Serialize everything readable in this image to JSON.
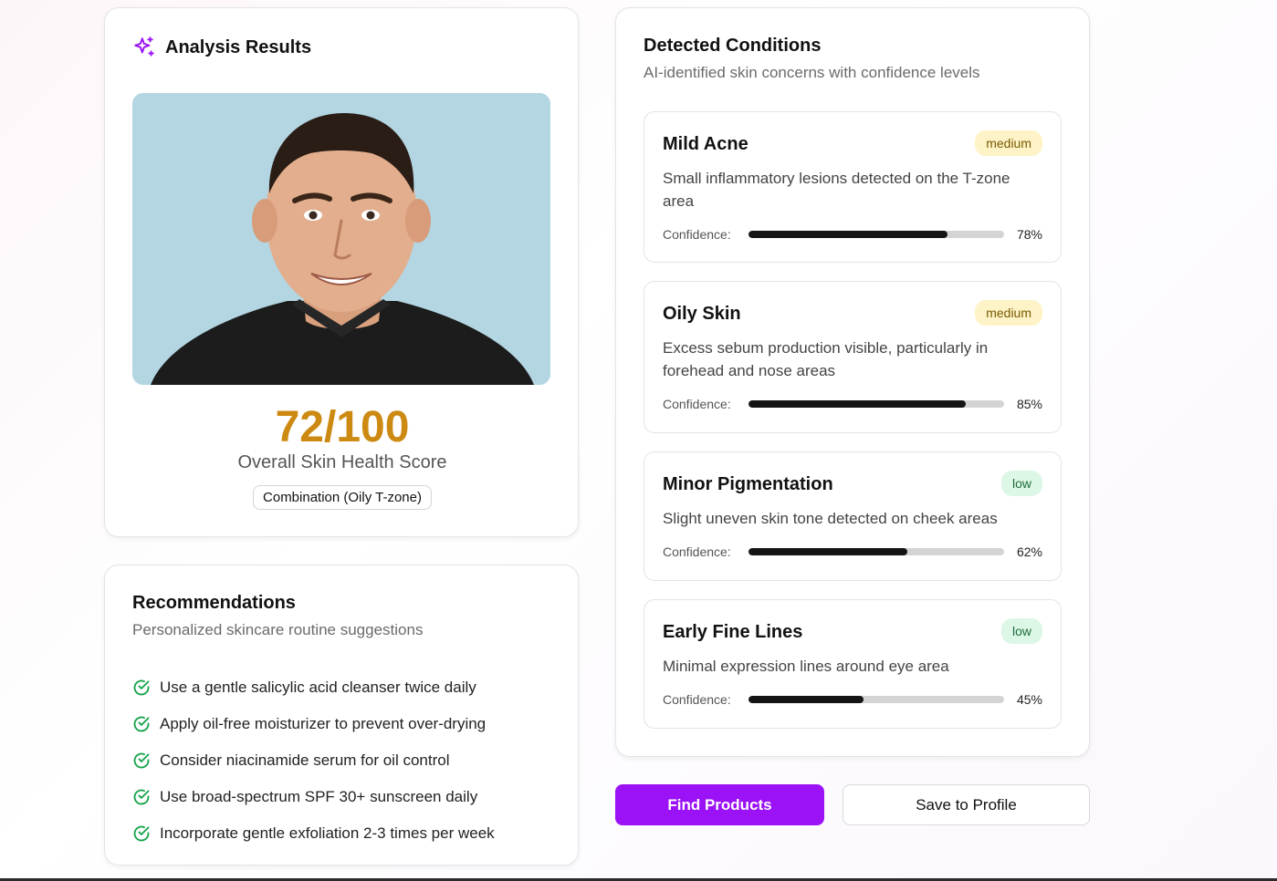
{
  "analysis": {
    "title": "Analysis Results",
    "icon": "sparkles-icon",
    "score": "72/100",
    "score_label": "Overall Skin Health Score",
    "skin_type": "Combination (Oily T-zone)",
    "colors": {
      "score": "#cd8a12",
      "icon": "#9a12f5",
      "photo_bg": "#b3d6e2"
    }
  },
  "recommendations": {
    "title": "Recommendations",
    "subtitle": "Personalized skincare routine suggestions",
    "items": [
      "Use a gentle salicylic acid cleanser twice daily",
      "Apply oil-free moisturizer to prevent over-drying",
      "Consider niacinamide serum for oil control",
      "Use broad-spectrum SPF 30+ sunscreen daily",
      "Incorporate gentle exfoliation 2-3 times per week"
    ],
    "icon": "check-circle-icon",
    "icon_color": "#16a34a"
  },
  "conditions": {
    "title": "Detected Conditions",
    "subtitle": "AI-identified skin concerns with confidence levels",
    "confidence_label": "Confidence:",
    "items": [
      {
        "name": "Mild Acne",
        "severity": "medium",
        "description": "Small inflammatory lesions detected on the T-zone area",
        "confidence": 78,
        "confidence_text": "78%"
      },
      {
        "name": "Oily Skin",
        "severity": "medium",
        "description": "Excess sebum production visible, particularly in forehead and nose areas",
        "confidence": 85,
        "confidence_text": "85%"
      },
      {
        "name": "Minor Pigmentation",
        "severity": "low",
        "description": "Slight uneven skin tone detected on cheek areas",
        "confidence": 62,
        "confidence_text": "62%"
      },
      {
        "name": "Early Fine Lines",
        "severity": "low",
        "description": "Minimal expression lines around eye area",
        "confidence": 45,
        "confidence_text": "45%"
      }
    ]
  },
  "actions": {
    "find_products": "Find Products",
    "save_profile": "Save to Profile",
    "primary_color": "#9a12f5"
  }
}
